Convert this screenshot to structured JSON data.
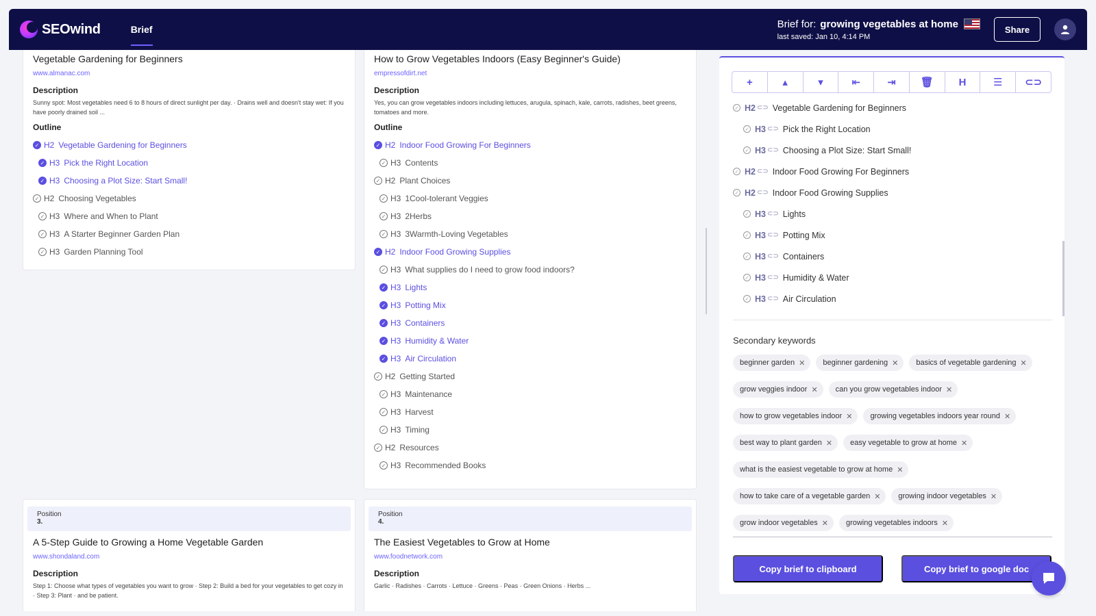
{
  "header": {
    "logo_text": "SEOwind",
    "nav_tab": "Brief",
    "brief_label": "Brief for:",
    "brief_keyword": "growing vegetables at home",
    "last_saved": "last saved: Jan 10, 4:14 PM",
    "share_label": "Share",
    "flag_icon": "us-flag-icon",
    "avatar_icon": "user-icon"
  },
  "cards": [
    {
      "title": "Vegetable Gardening for Beginners",
      "url": "www.almanac.com",
      "description_label": "Description",
      "description": "Sunny spot: Most vegetables need 6 to 8 hours of direct sunlight per day. · Drains well and doesn't stay wet: If you have poorly drained soil ...",
      "outline_label": "Outline",
      "outline": [
        {
          "level": "H2",
          "text": "Vegetable Gardening for Beginners",
          "selected": true
        },
        {
          "level": "H3",
          "text": "Pick the Right Location",
          "selected": true
        },
        {
          "level": "H3",
          "text": "Choosing a Plot Size: Start Small!",
          "selected": true
        },
        {
          "level": "H2",
          "text": "Choosing Vegetables",
          "selected": false
        },
        {
          "level": "H3",
          "text": "Where and When to Plant",
          "selected": false
        },
        {
          "level": "H3",
          "text": "A Starter Beginner Garden Plan",
          "selected": false
        },
        {
          "level": "H3",
          "text": "Garden Planning Tool",
          "selected": false
        }
      ]
    },
    {
      "title": "How to Grow Vegetables Indoors (Easy Beginner's Guide)",
      "url": "empressofdirt.net",
      "description_label": "Description",
      "description": "Yes, you can grow vegetables indoors including lettuces, arugula, spinach, kale, carrots, radishes, beet greens, tomatoes and more.",
      "outline_label": "Outline",
      "outline": [
        {
          "level": "H2",
          "text": "Indoor Food Growing For Beginners",
          "selected": true
        },
        {
          "level": "H3",
          "text": "Contents",
          "selected": false
        },
        {
          "level": "H2",
          "text": "Plant Choices",
          "selected": false
        },
        {
          "level": "H3",
          "text": "1Cool-tolerant Veggies",
          "selected": false
        },
        {
          "level": "H3",
          "text": "2Herbs",
          "selected": false
        },
        {
          "level": "H3",
          "text": "3Warmth-Loving Vegetables",
          "selected": false
        },
        {
          "level": "H2",
          "text": "Indoor Food Growing Supplies",
          "selected": true
        },
        {
          "level": "H3",
          "text": "What supplies do I need to grow food indoors?",
          "selected": false
        },
        {
          "level": "H3",
          "text": "Lights",
          "selected": true
        },
        {
          "level": "H3",
          "text": "Potting Mix",
          "selected": true
        },
        {
          "level": "H3",
          "text": "Containers",
          "selected": true
        },
        {
          "level": "H3",
          "text": "Humidity & Water",
          "selected": true
        },
        {
          "level": "H3",
          "text": "Air Circulation",
          "selected": true
        },
        {
          "level": "H2",
          "text": "Getting Started",
          "selected": false
        },
        {
          "level": "H3",
          "text": "Maintenance",
          "selected": false
        },
        {
          "level": "H3",
          "text": "Harvest",
          "selected": false
        },
        {
          "level": "H3",
          "text": "Timing",
          "selected": false
        },
        {
          "level": "H2",
          "text": "Resources",
          "selected": false
        },
        {
          "level": "H3",
          "text": "Recommended Books",
          "selected": false
        }
      ]
    },
    {
      "position_label": "Position",
      "position": "3.",
      "title": "A 5-Step Guide to Growing a Home Vegetable Garden",
      "url": "www.shondaland.com",
      "description_label": "Description",
      "description": "Step 1: Choose what types of vegetables you want to grow · Step 2: Build a bed for your vegetables to get cozy in · Step 3: Plant · and be patient."
    },
    {
      "position_label": "Position",
      "position": "4.",
      "title": "The Easiest Vegetables to Grow at Home",
      "url": "www.foodnetwork.com",
      "description_label": "Description",
      "description": "Garlic · Radishes · Carrots · Lettuce · Greens · Peas · Green Onions · Herbs ..."
    }
  ],
  "panel": {
    "toolbar": [
      {
        "icon": "plus-icon",
        "glyph": "+"
      },
      {
        "icon": "move-up-icon",
        "glyph": "▴"
      },
      {
        "icon": "move-down-icon",
        "glyph": "▾"
      },
      {
        "icon": "outdent-icon",
        "glyph": "⇤"
      },
      {
        "icon": "indent-icon",
        "glyph": "⇥"
      },
      {
        "icon": "trash-icon",
        "glyph": "🗑"
      },
      {
        "icon": "heading-icon",
        "glyph": "H"
      },
      {
        "icon": "list-icon",
        "glyph": "☰"
      },
      {
        "icon": "link-icon",
        "glyph": "⊂⊃"
      }
    ],
    "outline": [
      {
        "level": "H2",
        "text": "Vegetable Gardening for Beginners"
      },
      {
        "level": "H3",
        "text": "Pick the Right Location"
      },
      {
        "level": "H3",
        "text": "Choosing a Plot Size: Start Small!"
      },
      {
        "level": "H2",
        "text": "Indoor Food Growing For Beginners"
      },
      {
        "level": "H2",
        "text": "Indoor Food Growing Supplies"
      },
      {
        "level": "H3",
        "text": "Lights"
      },
      {
        "level": "H3",
        "text": "Potting Mix"
      },
      {
        "level": "H3",
        "text": "Containers"
      },
      {
        "level": "H3",
        "text": "Humidity & Water"
      },
      {
        "level": "H3",
        "text": "Air Circulation"
      }
    ],
    "secondary_keywords_title": "Secondary keywords",
    "keywords": [
      "beginner garden",
      "beginner gardening",
      "basics of vegetable gardening",
      "grow veggies indoor",
      "can you grow vegetables indoor",
      "how to grow vegetables indoor",
      "growing vegetables indoors year round",
      "best way to plant garden",
      "easy vegetable to grow at home",
      "what is the easiest vegetable to grow at home",
      "how to take care of a vegetable garden",
      "growing indoor vegetables",
      "grow indoor vegetables",
      "growing vegetables indoors"
    ],
    "copy_clipboard_label": "Copy brief to clipboard",
    "copy_gdoc_label": "Copy brief to google doc"
  },
  "colors": {
    "header_bg": "#0f0f47",
    "accent": "#5b4fe0"
  }
}
